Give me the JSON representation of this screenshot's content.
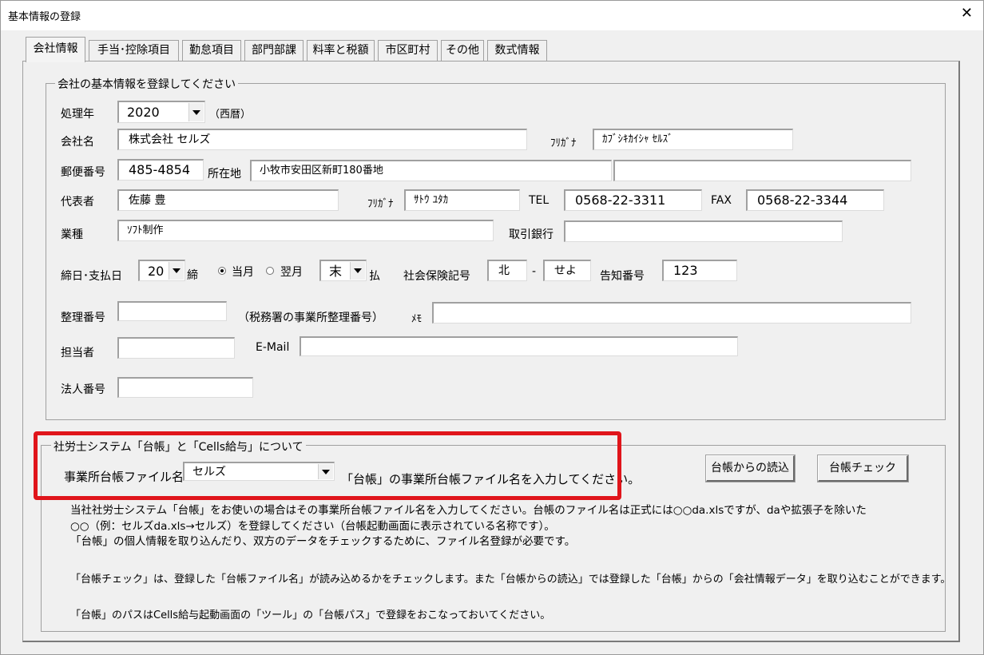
{
  "window": {
    "title": "基本情報の登録",
    "close_glyph": "✕"
  },
  "tabs": [
    {
      "label": "会社情報",
      "active": true
    },
    {
      "label": "手当･控除項目"
    },
    {
      "label": "勤怠項目"
    },
    {
      "label": "部門部課"
    },
    {
      "label": "料率と税額"
    },
    {
      "label": "市区町村"
    },
    {
      "label": "その他"
    },
    {
      "label": "数式情報"
    }
  ],
  "company_group": {
    "legend": "会社の基本情報を登録してください",
    "year_label": "処理年",
    "year_value": "2020",
    "year_era": "（西暦）",
    "name_label": "会社名",
    "name_value": "株式会社 セルズ",
    "name_kana_label": "ﾌﾘｶﾞﾅ",
    "name_kana_value": "ｶﾌﾞｼｷｶｲｼｬ ｾﾙｽﾞ",
    "zip_label": "郵便番号",
    "zip_value": "485-4854",
    "address_label": "所在地",
    "address1_value": "小牧市安田区新町180番地",
    "address2_value": "",
    "rep_label": "代表者",
    "rep_value": "佐藤 豊",
    "rep_kana_label": "ﾌﾘｶﾞﾅ",
    "rep_kana_value": "ｻﾄｳ ﾕﾀｶ",
    "tel_label": "TEL",
    "tel_value": "0568-22-3311",
    "fax_label": "FAX",
    "fax_value": "0568-22-3344",
    "industry_label": "業種",
    "industry_value": "ｿﾌﾄ制作",
    "bank_label": "取引銀行",
    "bank_value": "",
    "closing_label": "締日･支払日",
    "closing_value": "20",
    "closing_suffix": "締",
    "radio_current": "当月",
    "radio_next": "翌月",
    "pay_value": "末",
    "pay_suffix": "払",
    "insurance_label": "社会保険記号",
    "insurance_value1": "北",
    "insurance_dash": "-",
    "insurance_value2": "せよ",
    "notice_label": "告知番号",
    "notice_value": "123",
    "ref_label": "整理番号",
    "ref_value": "",
    "ref_note": "（税務署の事業所整理番号）",
    "memo_label": "ﾒﾓ",
    "memo_value": "",
    "staff_label": "担当者",
    "staff_value": "",
    "email_label": "E-Mail",
    "email_value": "",
    "corp_label": "法人番号",
    "corp_value": ""
  },
  "ledger_group": {
    "legend": "社労士システム「台帳」と「Cells給与」について",
    "file_label": "事業所台帳ファイル名",
    "file_value": "セルズ",
    "file_hint": "「台帳」の事業所台帳ファイル名を入力してください。",
    "import_button": "台帳からの読込",
    "check_button": "台帳チェック",
    "notes": [
      "当社社労士システム「台帳」をお使いの場合はその事業所台帳ファイル名を入力してください。台帳のファイル名は正式には○○da.xlsですが、daや拡張子を除いた",
      "○○（例：セルズda.xls→セルズ）を登録してください（台帳起動画面に表示されている名称です）。",
      "「台帳」の個人情報を取り込んだり、双方のデータをチェックするために、ファイル名登録が必要です。",
      "「台帳チェック」は、登録した「台帳ファイル名」が読み込めるかをチェックします。また「台帳からの読込」では登録した「台帳」からの「会社情報データ」を取り込むことができます。",
      "「台帳」のパスはCells給与起動画面の「ツール」の「台帳パス」で登録をおこなっておいてください。"
    ]
  },
  "colors": {
    "highlight": "#e0151b",
    "background": "#f0f0f0"
  }
}
